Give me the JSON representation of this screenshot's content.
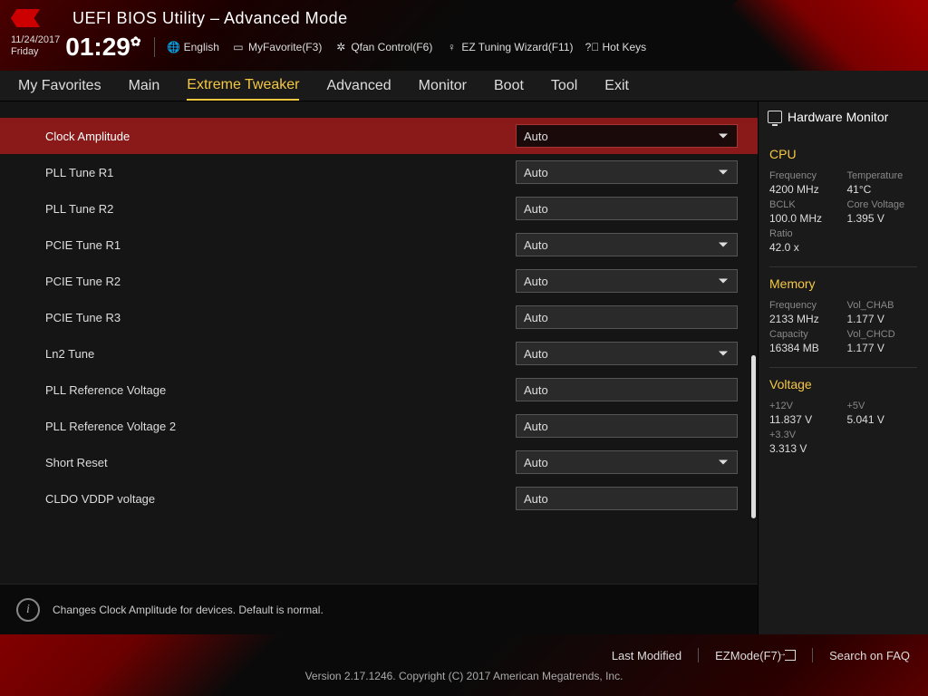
{
  "header": {
    "title": "UEFI BIOS Utility – Advanced Mode",
    "date": "11/24/2017",
    "day": "Friday",
    "time": "01:29",
    "toolbar": {
      "language": "English",
      "favorite": "MyFavorite(F3)",
      "qfan": "Qfan Control(F6)",
      "eztuning": "EZ Tuning Wizard(F11)",
      "hotkeys": "Hot Keys"
    }
  },
  "tabs": [
    "My Favorites",
    "Main",
    "Extreme Tweaker",
    "Advanced",
    "Monitor",
    "Boot",
    "Tool",
    "Exit"
  ],
  "active_tab": "Extreme Tweaker",
  "settings": [
    {
      "label": "Clock Amplitude",
      "value": "Auto",
      "type": "dropdown",
      "selected": true
    },
    {
      "label": "PLL Tune R1",
      "value": "Auto",
      "type": "dropdown"
    },
    {
      "label": "PLL Tune R2",
      "value": "Auto",
      "type": "text"
    },
    {
      "label": "PCIE Tune R1",
      "value": "Auto",
      "type": "dropdown"
    },
    {
      "label": "PCIE Tune R2",
      "value": "Auto",
      "type": "dropdown"
    },
    {
      "label": "PCIE Tune R3",
      "value": "Auto",
      "type": "text"
    },
    {
      "label": "Ln2 Tune",
      "value": "Auto",
      "type": "dropdown"
    },
    {
      "label": "PLL Reference Voltage",
      "value": "Auto",
      "type": "text"
    },
    {
      "label": "PLL Reference Voltage 2",
      "value": "Auto",
      "type": "text"
    },
    {
      "label": "Short Reset",
      "value": "Auto",
      "type": "dropdown"
    },
    {
      "label": "CLDO VDDP voltage",
      "value": "Auto",
      "type": "text"
    }
  ],
  "help_text": "Changes Clock Amplitude for devices. Default is normal.",
  "sidebar": {
    "title": "Hardware Monitor",
    "cpu": {
      "heading": "CPU",
      "freq_label": "Frequency",
      "freq": "4200 MHz",
      "temp_label": "Temperature",
      "temp": "41°C",
      "bclk_label": "BCLK",
      "bclk": "100.0 MHz",
      "cvolt_label": "Core Voltage",
      "cvolt": "1.395 V",
      "ratio_label": "Ratio",
      "ratio": "42.0 x"
    },
    "memory": {
      "heading": "Memory",
      "freq_label": "Frequency",
      "freq": "2133 MHz",
      "vchab_label": "Vol_CHAB",
      "vchab": "1.177 V",
      "cap_label": "Capacity",
      "cap": "16384 MB",
      "vchcd_label": "Vol_CHCD",
      "vchcd": "1.177 V"
    },
    "voltage": {
      "heading": "Voltage",
      "v12_label": "+12V",
      "v12": "11.837 V",
      "v5_label": "+5V",
      "v5": "5.041 V",
      "v33_label": "+3.3V",
      "v33": "3.313 V"
    }
  },
  "footer": {
    "last_modified": "Last Modified",
    "ezmode": "EZMode(F7)",
    "search": "Search on FAQ",
    "version": "Version 2.17.1246. Copyright (C) 2017 American Megatrends, Inc."
  }
}
